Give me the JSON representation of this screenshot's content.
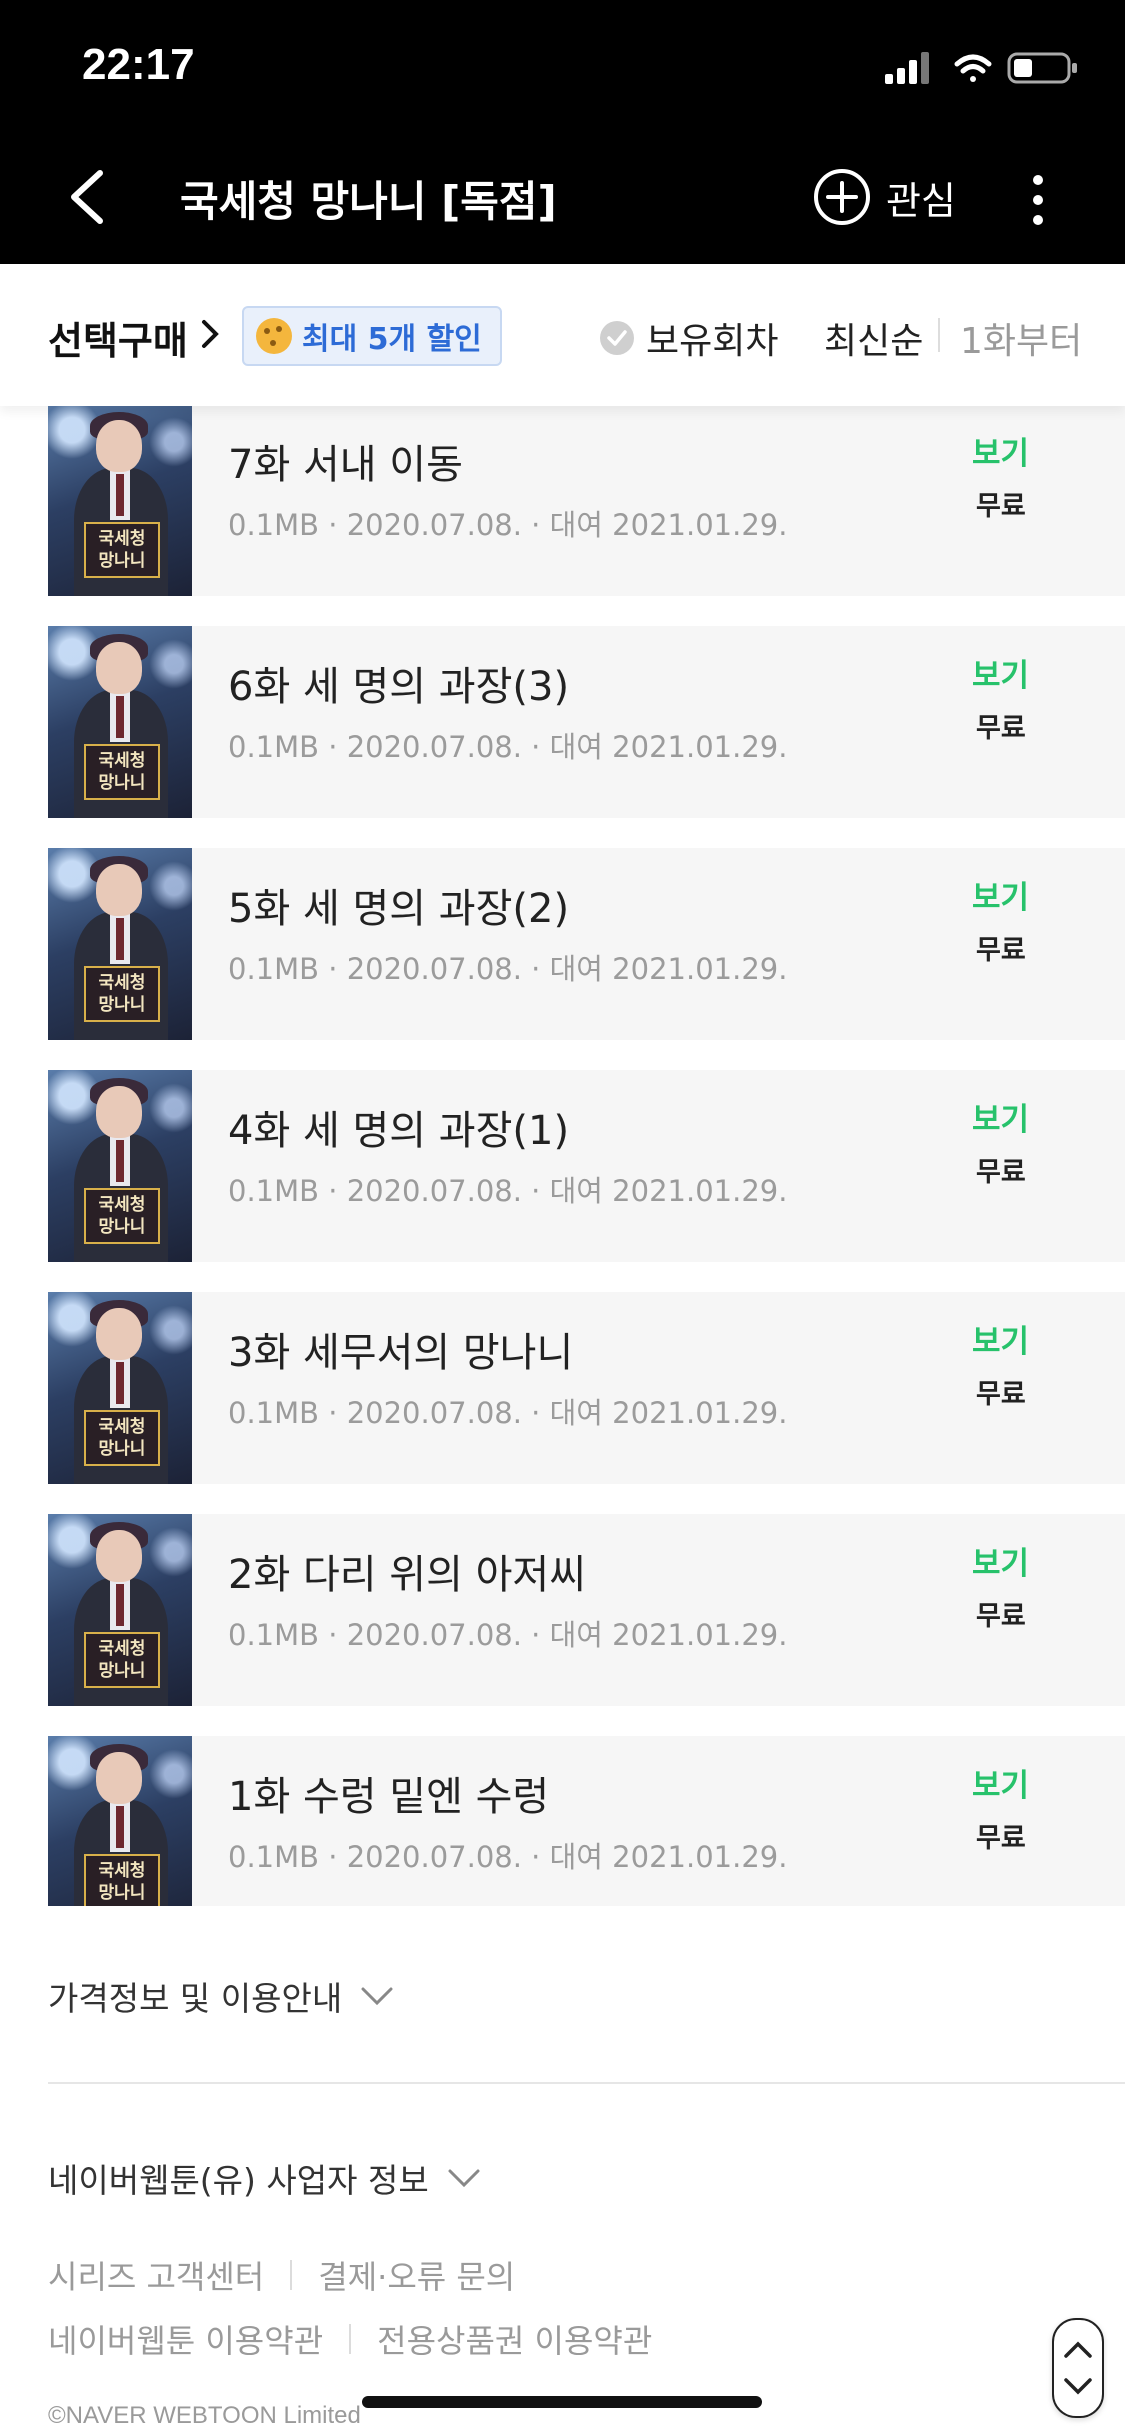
{
  "status_bar": {
    "time": "22:17"
  },
  "header": {
    "title": "국세청 망나니 [독점]",
    "favorite_label": "관심"
  },
  "toolbar": {
    "select_buy": "선택구매",
    "discount_badge": "최대 5개 할인",
    "owned_filter": "보유회차",
    "sort_latest": "최신순",
    "sort_first": "1화부터"
  },
  "thumbnail_text": "국세청\n망나니",
  "episodes": [
    {
      "title": "7화 서내 이동",
      "meta": "0.1MB · 2020.07.08. · 대여 2021.01.29.",
      "view": "보기",
      "price": "무료"
    },
    {
      "title": "6화 세 명의 과장(3)",
      "meta": "0.1MB · 2020.07.08. · 대여 2021.01.29.",
      "view": "보기",
      "price": "무료"
    },
    {
      "title": "5화 세 명의 과장(2)",
      "meta": "0.1MB · 2020.07.08. · 대여 2021.01.29.",
      "view": "보기",
      "price": "무료"
    },
    {
      "title": "4화 세 명의 과장(1)",
      "meta": "0.1MB · 2020.07.08. · 대여 2021.01.29.",
      "view": "보기",
      "price": "무료"
    },
    {
      "title": "3화 세무서의 망나니",
      "meta": "0.1MB · 2020.07.08. · 대여 2021.01.29.",
      "view": "보기",
      "price": "무료"
    },
    {
      "title": "2화 다리 위의 아저씨",
      "meta": "0.1MB · 2020.07.08. · 대여 2021.01.29.",
      "view": "보기",
      "price": "무료"
    },
    {
      "title": "1화 수렁 밑엔 수렁",
      "meta": "0.1MB · 2020.07.08. · 대여 2021.01.29.",
      "view": "보기",
      "price": "무료"
    }
  ],
  "footer": {
    "price_info": "가격정보 및 이용안내",
    "business_info": "네이버웹툰(유) 사업자 정보",
    "links_row1": [
      "시리즈 고객센터",
      "결제·오류 문의"
    ],
    "links_row2": [
      "네이버웹툰 이용약관",
      "전용상품권 이용약관"
    ],
    "copyright": "©NAVER WEBTOON Limited"
  },
  "colors": {
    "view_green": "#27c26b",
    "discount_blue": "#2d6bd6",
    "header_bg": "#000000"
  },
  "icons": [
    "back-arrow-icon",
    "plus-circle-icon",
    "more-vertical-icon",
    "cookie-icon",
    "check-circle-icon",
    "chevron-down-icon",
    "scroll-arrows-icon",
    "signal-icon",
    "wifi-icon",
    "battery-icon"
  ]
}
